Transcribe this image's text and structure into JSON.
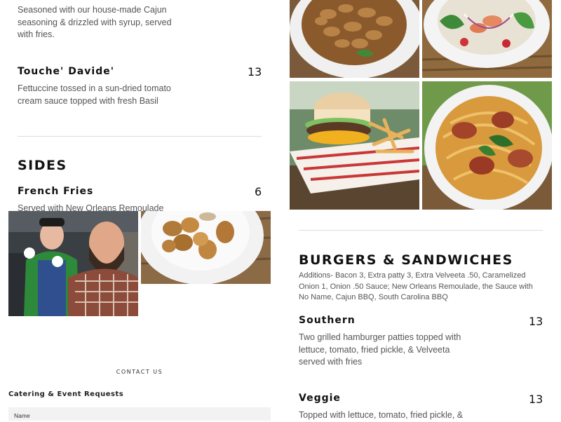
{
  "left_menu": {
    "cajun_desc": "Seasoned with our house-made Cajun seasoning & drizzled with syrup, served with fries.",
    "touche": {
      "name": "Touche' Davide'",
      "price": "13",
      "desc": "Fettuccine tossed in a sun-dried tomato cream sauce topped with fresh Basil"
    },
    "sides_title": "SIDES",
    "french_fries": {
      "name": "French Fries",
      "price": "6",
      "desc": "Served with New Orleans Remoulade"
    }
  },
  "contact": {
    "heading": "CONTACT US",
    "form_title": "Catering & Event Requests",
    "name_label": "Name"
  },
  "right_menu": {
    "section_title": "BURGERS & SANDWICHES",
    "additions": "Additions- Bacon 3, Extra patty 3, Extra Velveeta .50, Caramelized Onion 1, Onion .50 Sauce; New Orleans Remoulade, the Sauce with No Name, Cajun BBQ, South Carolina BBQ",
    "items": [
      {
        "name": "Southern",
        "price": "13",
        "desc": "Two grilled hamburger patties topped with lettuce, tomato, fried pickle, & Velveeta served with fries"
      },
      {
        "name": "Veggie",
        "price": "13",
        "desc": "Topped with lettuce, tomato, fried pickle, &"
      }
    ]
  }
}
